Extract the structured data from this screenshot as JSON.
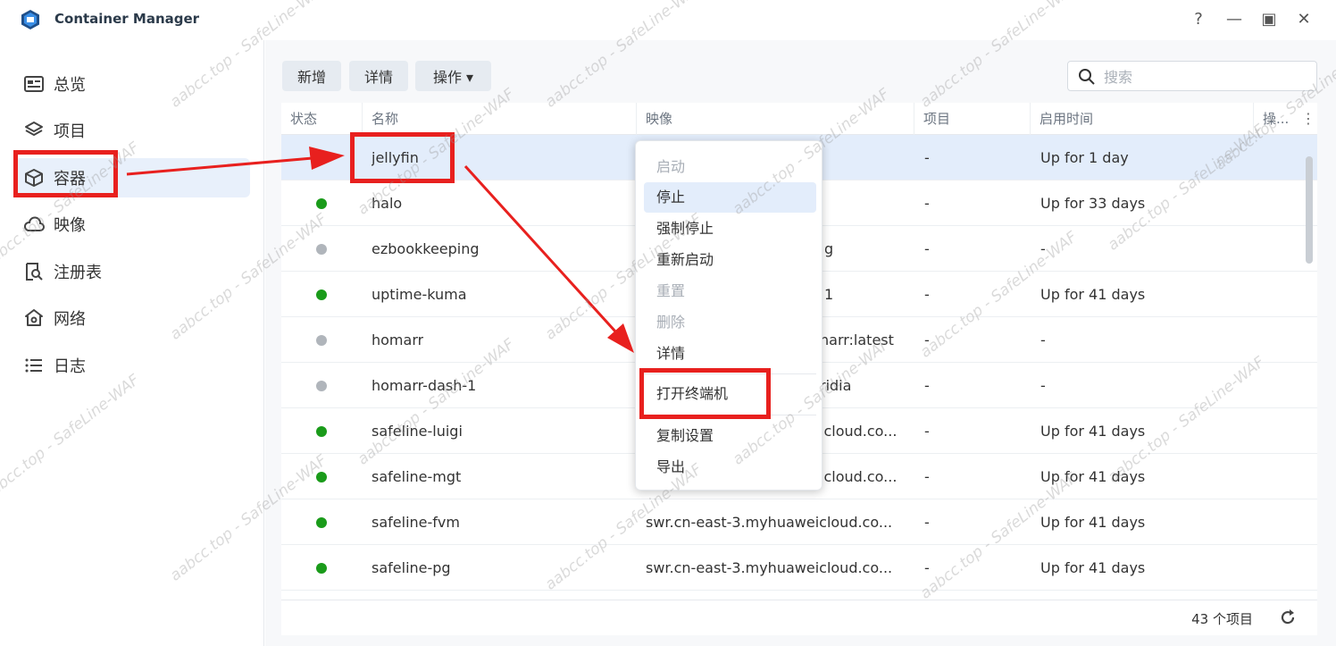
{
  "app": {
    "title": "Container Manager"
  },
  "window_controls": {
    "help": "?",
    "minimize": "—",
    "maximize": "▣",
    "close": "✕"
  },
  "sidebar": {
    "items": [
      {
        "label": "总览",
        "icon": "overview-icon"
      },
      {
        "label": "项目",
        "icon": "layers-icon"
      },
      {
        "label": "容器",
        "icon": "cube-icon",
        "active": true
      },
      {
        "label": "映像",
        "icon": "cloud-icon"
      },
      {
        "label": "注册表",
        "icon": "registry-search-icon"
      },
      {
        "label": "网络",
        "icon": "network-home-icon"
      },
      {
        "label": "日志",
        "icon": "list-icon"
      }
    ]
  },
  "toolbar": {
    "add_label": "新增",
    "details_label": "详情",
    "actions_label": "操作 ▾",
    "search_placeholder": "搜索"
  },
  "table": {
    "columns": [
      "状态",
      "名称",
      "映像",
      "项目",
      "启用时间",
      "操..."
    ],
    "rows": [
      {
        "status": "",
        "name": "jellyfin",
        "image": "",
        "project": "-",
        "uptime": "Up for 1 day"
      },
      {
        "status": "running",
        "name": "halo",
        "image": "",
        "project": "-",
        "uptime": "Up for 33 days"
      },
      {
        "status": "stopped",
        "name": "ezbookkeeping",
        "image": "g",
        "project": "-",
        "uptime": "-"
      },
      {
        "status": "running",
        "name": "uptime-kuma",
        "image": "1",
        "project": "-",
        "uptime": "Up for 41 days"
      },
      {
        "status": "stopped",
        "name": "homarr",
        "image": "narr:latest",
        "project": "-",
        "uptime": "-"
      },
      {
        "status": "stopped",
        "name": "homarr-dash-1",
        "image": "ridia",
        "project": "-",
        "uptime": "-"
      },
      {
        "status": "running",
        "name": "safeline-luigi",
        "image": "icloud.co...",
        "project": "-",
        "uptime": "Up for 41 days"
      },
      {
        "status": "running",
        "name": "safeline-mgt",
        "image": "icloud.co...",
        "project": "-",
        "uptime": "Up for 41 days"
      },
      {
        "status": "running",
        "name": "safeline-fvm",
        "image": "swr.cn-east-3.myhuaweicloud.co...",
        "project": "-",
        "uptime": "Up for 41 days"
      },
      {
        "status": "running",
        "name": "safeline-pg",
        "image": "swr.cn-east-3.myhuaweicloud.co...",
        "project": "-",
        "uptime": "Up for 41 days"
      }
    ]
  },
  "footer": {
    "count": "43 个项目"
  },
  "context_menu": {
    "items": [
      {
        "label": "启动",
        "disabled": true
      },
      {
        "label": "停止",
        "hover": true
      },
      {
        "label": "强制停止"
      },
      {
        "label": "重新启动"
      },
      {
        "label": "重置",
        "disabled": true
      },
      {
        "label": "删除",
        "disabled": true
      },
      {
        "label": "详情"
      },
      {
        "label": "打开终端机",
        "highlighted": true
      },
      {
        "label": "复制设置"
      },
      {
        "label": "导出"
      }
    ]
  },
  "status_colors": {
    "running": "#1a9b1a",
    "stopped": "#b0b5bb"
  },
  "accent_color": "#e8201e",
  "watermark": "aabcc.top - SafeLine-WAF"
}
